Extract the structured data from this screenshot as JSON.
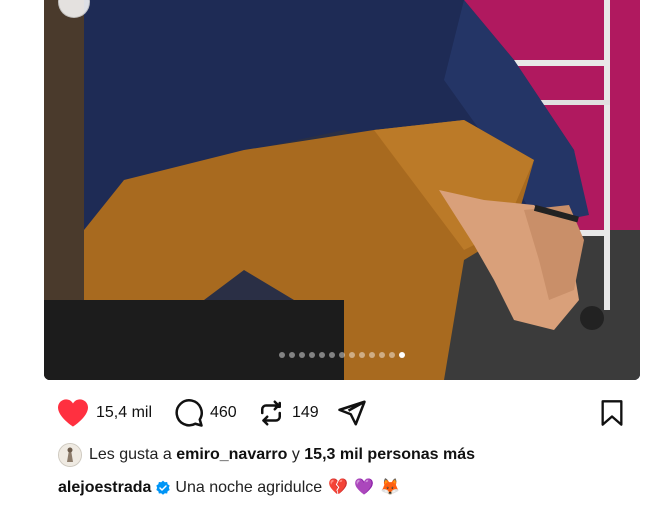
{
  "post": {
    "dots_total": 13,
    "active_dot_index": 12
  },
  "actions": {
    "like_count": "15,4 mil",
    "comment_count": "460",
    "repost_count": "149"
  },
  "likes": {
    "prefix": "Les gusta a",
    "user": "emiro_navarro",
    "connector": "y",
    "others": "15,3 mil personas más"
  },
  "caption": {
    "username": "alejoestrada",
    "text": "Una noche agridulce",
    "emojis": [
      "💔",
      "💜",
      "🦊"
    ]
  },
  "colors": {
    "like_red": "#ff3040",
    "verified_blue": "#0095f6",
    "heart_broken": "#e0245e",
    "heart_purple": "#8e3fd6"
  }
}
